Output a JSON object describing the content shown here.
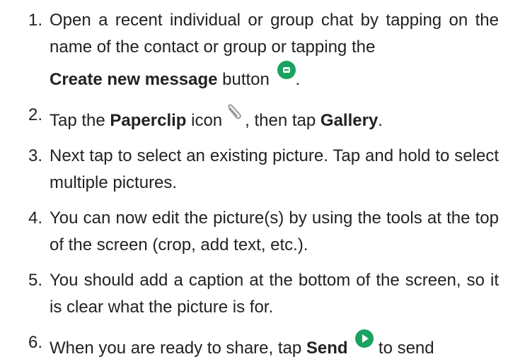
{
  "steps": [
    {
      "num": "1.",
      "t1": "Open a recent individual or group chat by tapping on the name of the contact or group or tapping the ",
      "b1": "Create new message",
      "t2": " button",
      "t3": "."
    },
    {
      "num": "2.",
      "t1": "Tap the ",
      "b1": "Paperclip",
      "t2": " icon",
      "t3": ", then tap ",
      "b2": "Gallery",
      "t4": "."
    },
    {
      "num": "3.",
      "t1": "Next tap to select an existing picture. Tap and hold to select multiple pictures."
    },
    {
      "num": "4.",
      "t1": "You can now edit the picture(s) by using the tools at the top of the screen (crop, add text, etc.)."
    },
    {
      "num": "5.",
      "t1": "You should add a caption at the bottom of the screen, so it is clear what the picture is for."
    },
    {
      "num": "6.",
      "t1": "When you are ready to share, tap ",
      "b1": "Send",
      "t2": " to send"
    }
  ],
  "icons": {
    "create_message": "create-message-icon",
    "paperclip": "paperclip-icon",
    "send": "send-icon"
  },
  "colors": {
    "accent": "#1aa260",
    "text": "#222222"
  }
}
